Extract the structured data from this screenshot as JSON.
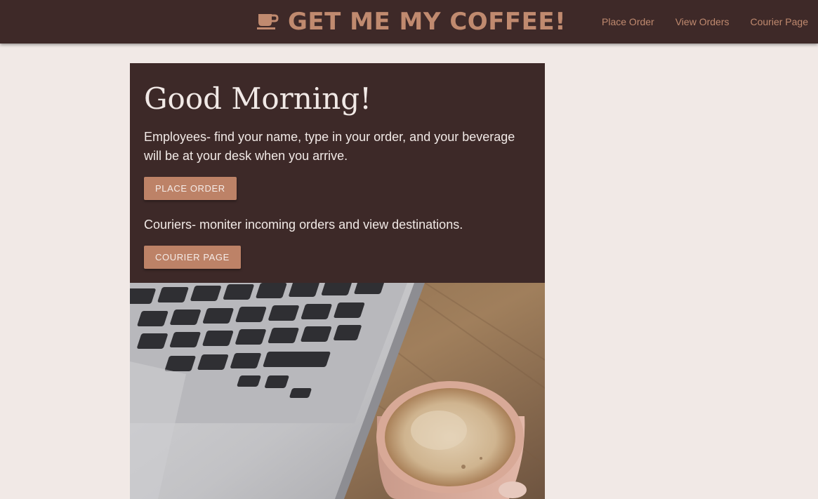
{
  "header": {
    "brand_icon": "coffee-cup-icon",
    "title": "GET ME MY COFFEE!",
    "nav": [
      {
        "label": "Place Order"
      },
      {
        "label": "View Orders"
      },
      {
        "label": "Courier Page"
      }
    ]
  },
  "hero": {
    "heading": "Good Morning!",
    "employees_text": "Employees- find your name, type in your order, and your beverage will be at your desk when you arrive.",
    "place_order_button": "PLACE ORDER",
    "couriers_text": "Couriers- moniter incoming orders and view destinations.",
    "courier_button": "COURIER PAGE"
  },
  "colors": {
    "nav_bg": "#3e2928",
    "accent": "#c08a6f",
    "button": "#bd8267",
    "page_bg": "#f1e9e6"
  }
}
